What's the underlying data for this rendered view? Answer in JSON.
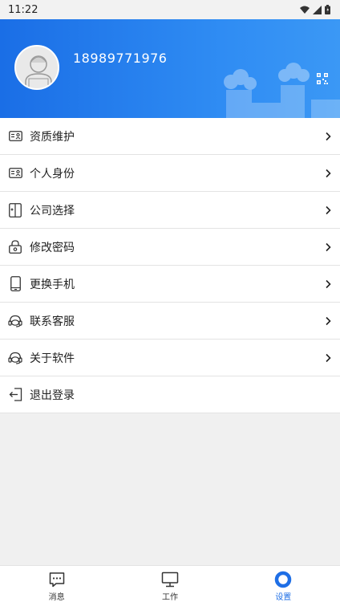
{
  "status_bar": {
    "time": "11:22"
  },
  "profile": {
    "phone": "18989771976"
  },
  "menu": [
    {
      "label": "资质维护",
      "icon": "id-card-icon"
    },
    {
      "label": "个人身份",
      "icon": "id-card-icon"
    },
    {
      "label": "公司选择",
      "icon": "company-switch-icon"
    },
    {
      "label": "修改密码",
      "icon": "lock-icon"
    },
    {
      "label": "更换手机",
      "icon": "phone-icon"
    },
    {
      "label": "联系客服",
      "icon": "headset-icon"
    },
    {
      "label": "关于软件",
      "icon": "headset-icon"
    },
    {
      "label": "退出登录",
      "icon": "logout-icon"
    }
  ],
  "tabs": [
    {
      "label": "消息",
      "icon": "message-icon"
    },
    {
      "label": "工作",
      "icon": "monitor-icon"
    },
    {
      "label": "设置",
      "icon": "settings-ring-icon",
      "active": true
    }
  ],
  "colors": {
    "accent": "#1f6fe6",
    "header_start": "#1a6ee6",
    "header_end": "#3b98f5"
  }
}
